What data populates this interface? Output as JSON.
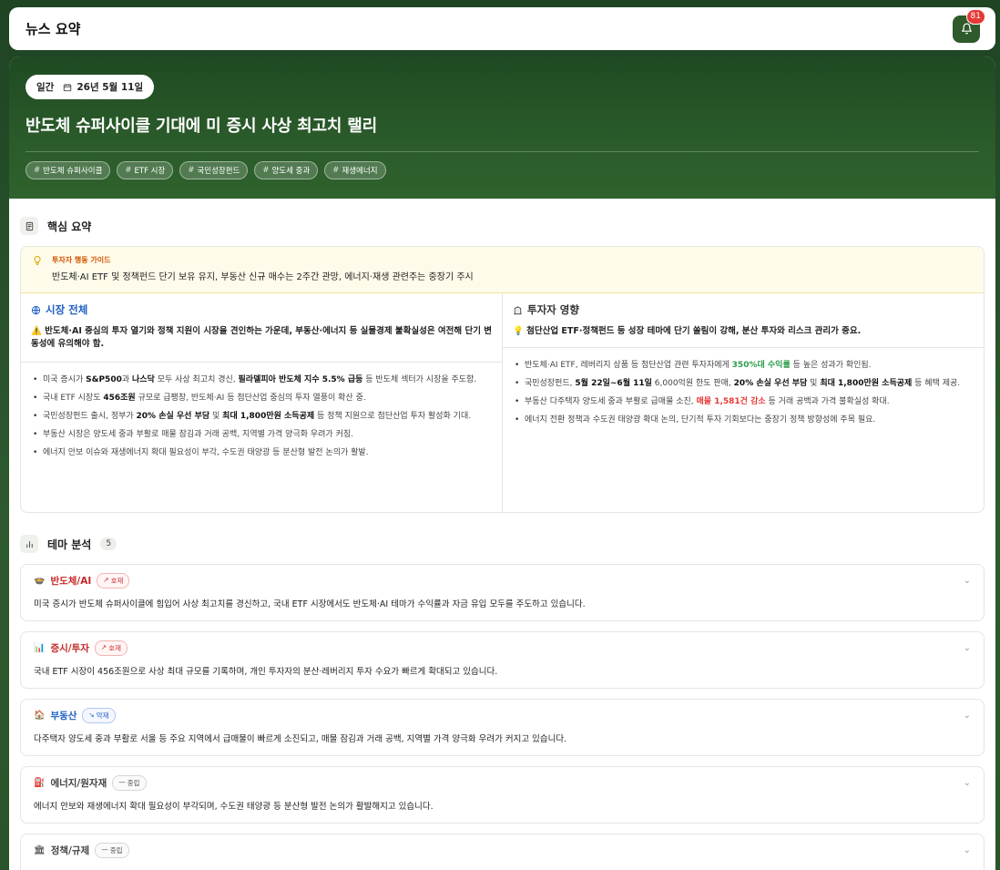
{
  "header": {
    "title": "뉴스 요약",
    "notification_count": "81"
  },
  "hero": {
    "type": "일간",
    "date": "26년 5월 11일",
    "title": "반도체 슈퍼사이클 기대에 미 증시 사상 최고치 랠리",
    "tags": [
      "반도체 슈퍼사이클",
      "ETF 시장",
      "국민성장펀드",
      "양도세 중과",
      "재생에너지"
    ]
  },
  "summary": {
    "section_title": "핵심 요약",
    "guide_label": "투자자 행동 가이드",
    "guide_text": "반도체·AI ETF 및 정책펀드 단기 보유 유지, 부동산 신규 매수는 2주간 관망, 에너지·재생 관련주는 중장기 주시",
    "market": {
      "title": "시장 전체",
      "lead": "⚠️ 반도체·AI 중심의 투자 열기와 정책 지원이 시장을 견인하는 가운데, 부동산·에너지 등 실물경제 불확실성은 여전해 단기 변동성에 유의해야 함.",
      "bullets": [
        [
          {
            "t": "미국 증시가 "
          },
          {
            "t": "S&P500",
            "b": true
          },
          {
            "t": "과 "
          },
          {
            "t": "나스닥",
            "b": true
          },
          {
            "t": " 모두 사상 최고치 경신, "
          },
          {
            "t": "필라델피아 반도체 지수 5.5% 급등",
            "b": true
          },
          {
            "t": " 등 반도체 섹터가 시장을 주도함."
          }
        ],
        [
          {
            "t": "국내 ETF 시장도 "
          },
          {
            "t": "456조원",
            "b": true
          },
          {
            "t": " 규모로 급팽창, 반도체·AI 등 첨단산업 중심의 투자 열풍이 확산 중."
          }
        ],
        [
          {
            "t": "국민성장펀드 출시, 정부가 "
          },
          {
            "t": "20% 손실 우선 부담",
            "b": true
          },
          {
            "t": " 및 "
          },
          {
            "t": "최대 1,800만원 소득공제",
            "b": true
          },
          {
            "t": " 등 정책 지원으로 첨단산업 투자 활성화 기대."
          }
        ],
        [
          {
            "t": "부동산 시장은 양도세 중과 부활로 매물 잠김과 거래 공백, 지역별 가격 양극화 우려가 커짐."
          }
        ],
        [
          {
            "t": "에너지 안보 이슈와 재생에너지 확대 필요성이 부각, 수도권 태양광 등 분산형 발전 논의가 활발."
          }
        ]
      ]
    },
    "investor": {
      "title": "투자자 영향",
      "lead": "💡 첨단산업 ETF·정책펀드 등 성장 테마에 단기 쏠림이 강해, 분산 투자와 리스크 관리가 중요.",
      "bullets": [
        [
          {
            "t": "반도체·AI ETF, 레버리지 상품 등 첨단산업 관련 투자자에게 "
          },
          {
            "t": "350%대 수익률",
            "g": true
          },
          {
            "t": " 등 높은 성과가 확인됨."
          }
        ],
        [
          {
            "t": "국민성장펀드, "
          },
          {
            "t": "5월 22일~6월 11일",
            "b": true
          },
          {
            "t": " 6,000억원 한도 판매, "
          },
          {
            "t": "20% 손실 우선 부담",
            "b": true
          },
          {
            "t": " 및 "
          },
          {
            "t": "최대 1,800만원 소득공제",
            "b": true
          },
          {
            "t": " 등 혜택 제공."
          }
        ],
        [
          {
            "t": "부동산 다주택자 양도세 중과 부활로 급매물 소진, "
          },
          {
            "t": "매물 1,581건 감소",
            "r": true
          },
          {
            "t": " 등 거래 공백과 가격 불확실성 확대."
          }
        ],
        [
          {
            "t": "에너지 전환 정책과 수도권 태양광 확대 논의, 단기적 투자 기회보다는 중장기 정책 방향성에 주목 필요."
          }
        ]
      ]
    }
  },
  "themes": {
    "section_title": "테마 분석",
    "count": "5",
    "items": [
      {
        "emoji": "🍲",
        "name": "반도체/AI",
        "color": "#c62828",
        "badge": "호재",
        "badge_type": "pos",
        "desc": "미국 증시가 반도체 슈퍼사이클에 힘입어 사상 최고치를 경신하고, 국내 ETF 시장에서도 반도체·AI 테마가 수익률과 자금 유입 모두를 주도하고 있습니다."
      },
      {
        "emoji": "📊",
        "name": "증시/투자",
        "color": "#c62828",
        "badge": "호재",
        "badge_type": "pos",
        "desc": "국내 ETF 시장이 456조원으로 사상 최대 규모를 기록하며, 개인 투자자의 분산·레버리지 투자 수요가 빠르게 확대되고 있습니다."
      },
      {
        "emoji": "🏠",
        "name": "부동산",
        "color": "#1f5fc4",
        "badge": "악재",
        "badge_type": "neg",
        "desc": "다주택자 양도세 중과 부활로 서울 등 주요 지역에서 급매물이 빠르게 소진되고, 매물 잠김과 거래 공백, 지역별 가격 양극화 우려가 커지고 있습니다."
      },
      {
        "emoji": "⛽",
        "name": "에너지/원자재",
        "color": "#444444",
        "badge": "중립",
        "badge_type": "neu",
        "desc": "에너지 안보와 재생에너지 확대 필요성이 부각되며, 수도권 태양광 등 분산형 발전 논의가 활발해지고 있습니다."
      },
      {
        "emoji": "🏛",
        "name": "정책/규제",
        "color": "#444444",
        "badge": "중립",
        "badge_type": "neu",
        "desc": ""
      }
    ]
  }
}
